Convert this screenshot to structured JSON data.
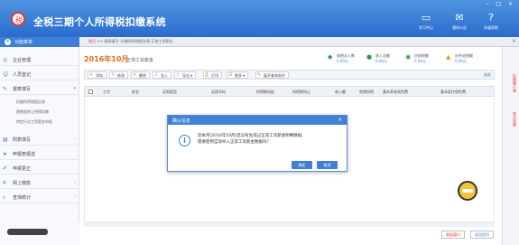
{
  "app": {
    "title": "全税三期个人所得税扣缴系统"
  },
  "topnav": [
    {
      "icon": "learning-icon",
      "label": "学习中心"
    },
    {
      "icon": "mail-icon",
      "label": "通知公告"
    },
    {
      "icon": "help-icon",
      "label": "升级帮助"
    }
  ],
  "window_controls": "– □ ×",
  "sidebar": {
    "header": "功能菜单",
    "items": [
      {
        "label": "企业管理",
        "icon": "company-icon"
      },
      {
        "label": "人员登记",
        "icon": "person-icon"
      },
      {
        "label": "报表填写",
        "icon": "form-icon"
      },
      {
        "label": "附表填写",
        "icon": "table-icon"
      },
      {
        "label": "申报表报送",
        "icon": "send-icon"
      },
      {
        "label": "申报更正",
        "icon": "edit-icon"
      },
      {
        "label": "网上缴款",
        "icon": "pay-icon"
      },
      {
        "label": "查询统计",
        "icon": "search-icon"
      }
    ],
    "subitems": [
      "扣缴所得税报告表",
      "限售股转让所得扣缴",
      "特定行业工资薪金申报"
    ]
  },
  "breadcrumb": {
    "home": "首页",
    "path": ">> 报表填写 -扣缴所得税报告表-正常工资薪金"
  },
  "period": {
    "value": "2016年10月",
    "subtitle": "正常工资薪金"
  },
  "stats": [
    {
      "icon": "people-icon",
      "label": "纳税总人数",
      "value": "0.00元",
      "color": "#2e9b4a"
    },
    {
      "icon": "income-icon",
      "label": "收入总额",
      "value": "0.00元",
      "color": "#2e9b4a"
    },
    {
      "icon": "tax-icon",
      "label": "应纳税额",
      "value": "0.00元",
      "color": "#2e9b4a"
    },
    {
      "icon": "refund-icon",
      "label": "应补退税额",
      "value": "0.00元",
      "color": "#e0a21a"
    }
  ],
  "toolbar": [
    "添加",
    "修改",
    "删除",
    "导入",
    "导出",
    "打印",
    "更多",
    "展开查询条件"
  ],
  "toolbar_more": "收起",
  "columns": [
    "工号",
    "姓名",
    "证照类型",
    "证照号码",
    "所得期间起",
    "所得期间止",
    "收入额",
    "免税所得",
    "基本养老保险费",
    "基本医疗保险费"
  ],
  "rightbar": [
    "扣缴客户端",
    "常见问题"
  ],
  "bottom_buttons": [
    "收起窗口",
    "返回首页"
  ],
  "dialog": {
    "title": "确认信息",
    "message_line1": "您本月[2016年10月]还没有生成过正常工资薪金明细数据,",
    "message_line2": "需要使用自动导入正常工资薪金数据吗？",
    "ok_label": "确定",
    "cancel_label": "取消"
  },
  "colors": {
    "brand": "#2a6bcd",
    "accent": "#e26d1f",
    "dialog_header": "#3f7fd6"
  }
}
